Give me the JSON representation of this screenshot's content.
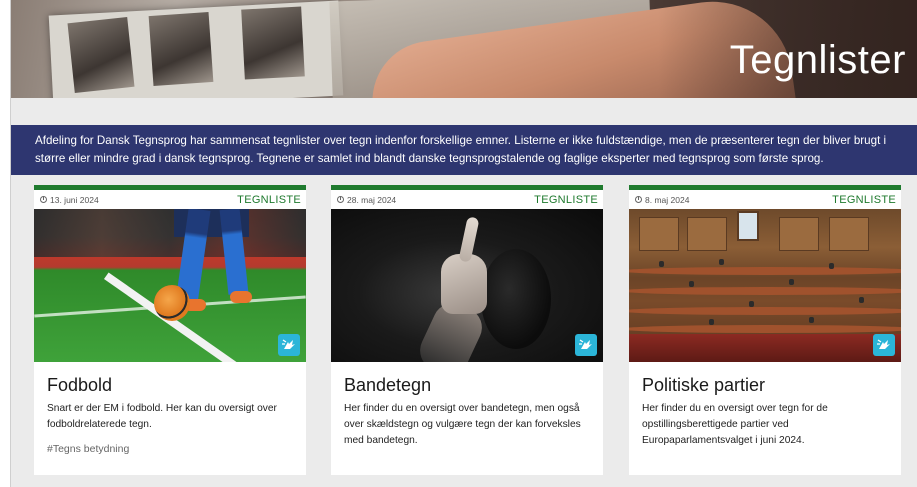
{
  "hero": {
    "title": "Tegnlister"
  },
  "intro": {
    "text": "Afdeling for Dansk Tegnsprog har sammensat tegnlister over tegn indenfor forskellige emner. Listerne er ikke fuldstændige, men de præsenterer tegn der bliver brugt i større eller mindre grad i dansk tegnsprog. Tegnene er samlet ind blandt danske tegnsprogstalende og faglige eksperter med tegnsprog som første sprog."
  },
  "colors": {
    "accent_green": "#1f7a2e",
    "band_navy": "#2e3670",
    "badge_cyan": "#2bb5d8"
  },
  "cards": [
    {
      "date": "13. juni 2024",
      "tag": "TEGNLISTE",
      "title": "Fodbold",
      "description": "Snart er der EM i fodbold. Her kan du oversigt over fodboldrelaterede tegn.",
      "hashtag": "#Tegns betydning",
      "icon": "sign-language-icon"
    },
    {
      "date": "28. maj 2024",
      "tag": "TEGNLISTE",
      "title": "Bandetegn",
      "description": "Her finder du en oversigt over bandetegn, men også over skældstegn og vulgære tegn der kan forveksles med bandetegn.",
      "icon": "sign-language-icon"
    },
    {
      "date": "8. maj 2024",
      "tag": "TEGNLISTE",
      "title": "Politiske partier",
      "description": "Her finder du en oversigt over tegn for de opstillingsberettigede partier ved Europaparlamentsvalget i juni 2024.",
      "icon": "sign-language-icon"
    }
  ]
}
